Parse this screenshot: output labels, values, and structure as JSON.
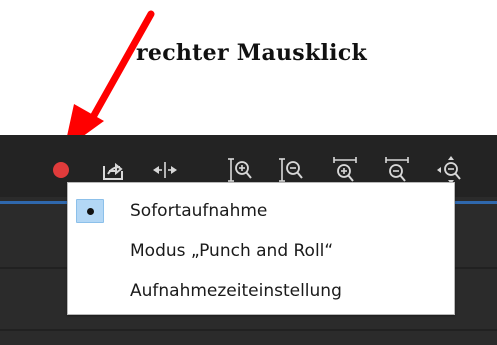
{
  "annotation": {
    "text": "rechter Mausklick",
    "arrow_color": "#ff0000"
  },
  "toolbar": {
    "accent": "#2f6bb4",
    "buttons": [
      {
        "icon": "record-dot-icon",
        "color": "#e03b3b"
      },
      {
        "icon": "export-icon"
      },
      {
        "icon": "split-arrows-icon"
      },
      {
        "icon": "zoom-in-vertical-icon"
      },
      {
        "icon": "zoom-out-vertical-icon"
      },
      {
        "icon": "zoom-in-horizontal-icon"
      },
      {
        "icon": "zoom-out-horizontal-icon"
      },
      {
        "icon": "zoom-fit-icon"
      }
    ]
  },
  "context_menu": {
    "items": [
      {
        "label": "Sofortaufnahme",
        "selected": true
      },
      {
        "label": "Modus „Punch and Roll“",
        "selected": false
      },
      {
        "label": "Aufnahmezeiteinstellung",
        "selected": false
      }
    ]
  }
}
